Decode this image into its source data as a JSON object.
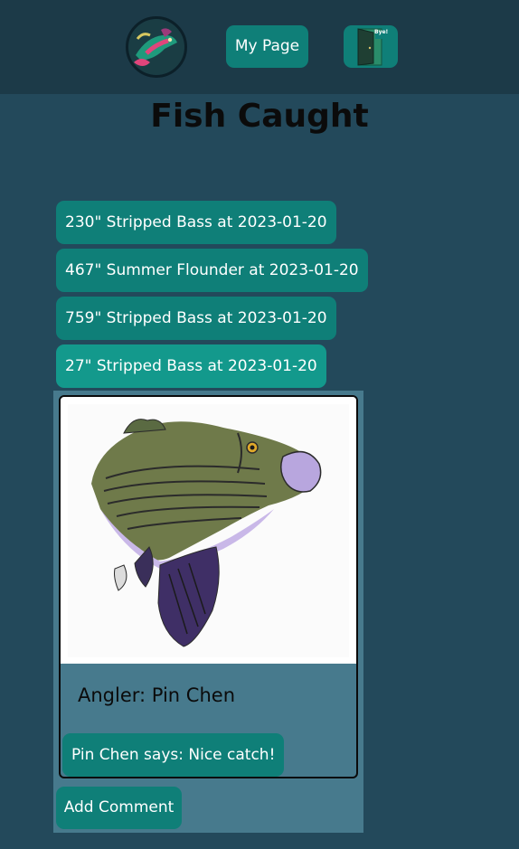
{
  "header": {
    "logo_icon": "bass-fish-logo-icon",
    "my_page_label": "My Page",
    "exit_icon": "exit-door-icon",
    "exit_text": "Bye!"
  },
  "page_title": "Fish Caught",
  "catches": [
    {
      "label": "230\" Stripped Bass at 2023-01-20",
      "selected": false
    },
    {
      "label": "467\" Summer Flounder at 2023-01-20",
      "selected": false
    },
    {
      "label": "759\" Stripped Bass at 2023-01-20",
      "selected": false
    },
    {
      "label": "27\" Stripped Bass at 2023-01-20",
      "selected": true
    }
  ],
  "detail": {
    "image_icon": "striped-bass-illustration",
    "angler": "Angler: Pin Chen",
    "comments": [
      "Pin Chen says: Nice catch!"
    ],
    "add_comment_label": "Add Comment"
  },
  "colors": {
    "page_background": "#23495b",
    "header_background": "#1c3a48",
    "button": "#0f7f78",
    "selected_button": "#13998c",
    "panel": "#477a8d"
  }
}
